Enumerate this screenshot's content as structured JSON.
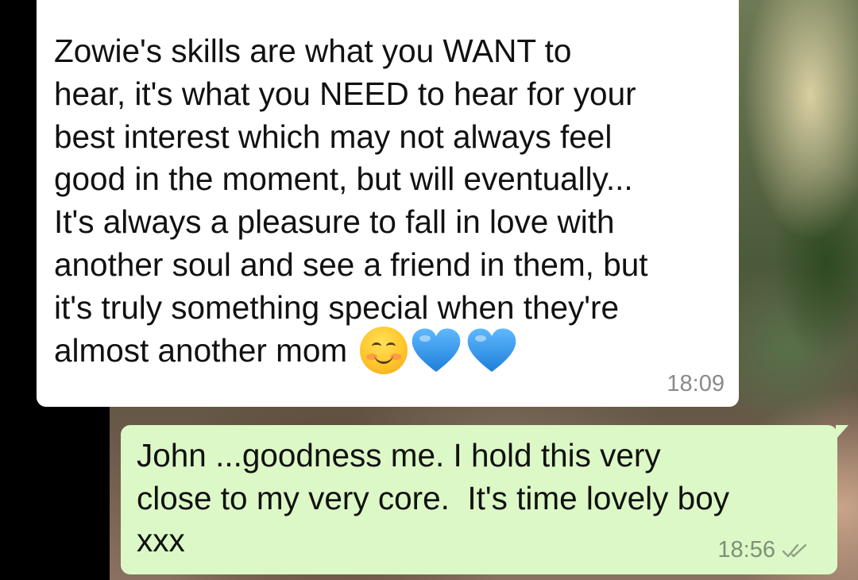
{
  "incoming_message": {
    "text": "Zowie's skills are what you WANT to\nhear, it's what you NEED to hear for your\nbest interest which may not always feel\ngood in the moment, but will eventually...\nIt's always a pleasure to fall in love with\nanother soul and see a friend in them, but\nit's truly something special when they're\nalmost another mom",
    "emojis": [
      "smiling-face-icon",
      "blue-heart-icon",
      "blue-heart-icon"
    ],
    "time": "18:09"
  },
  "outgoing_message": {
    "text": "John ...goodness me. I hold this very\nclose to my very core.  It's time lovely boy\nxxx",
    "time": "18:56",
    "status_icon": "double-check-icon"
  },
  "colors": {
    "incoming_bubble": "#ffffff",
    "outgoing_bubble": "#dcf8c6",
    "heart_blue": "#3aa0ef"
  }
}
